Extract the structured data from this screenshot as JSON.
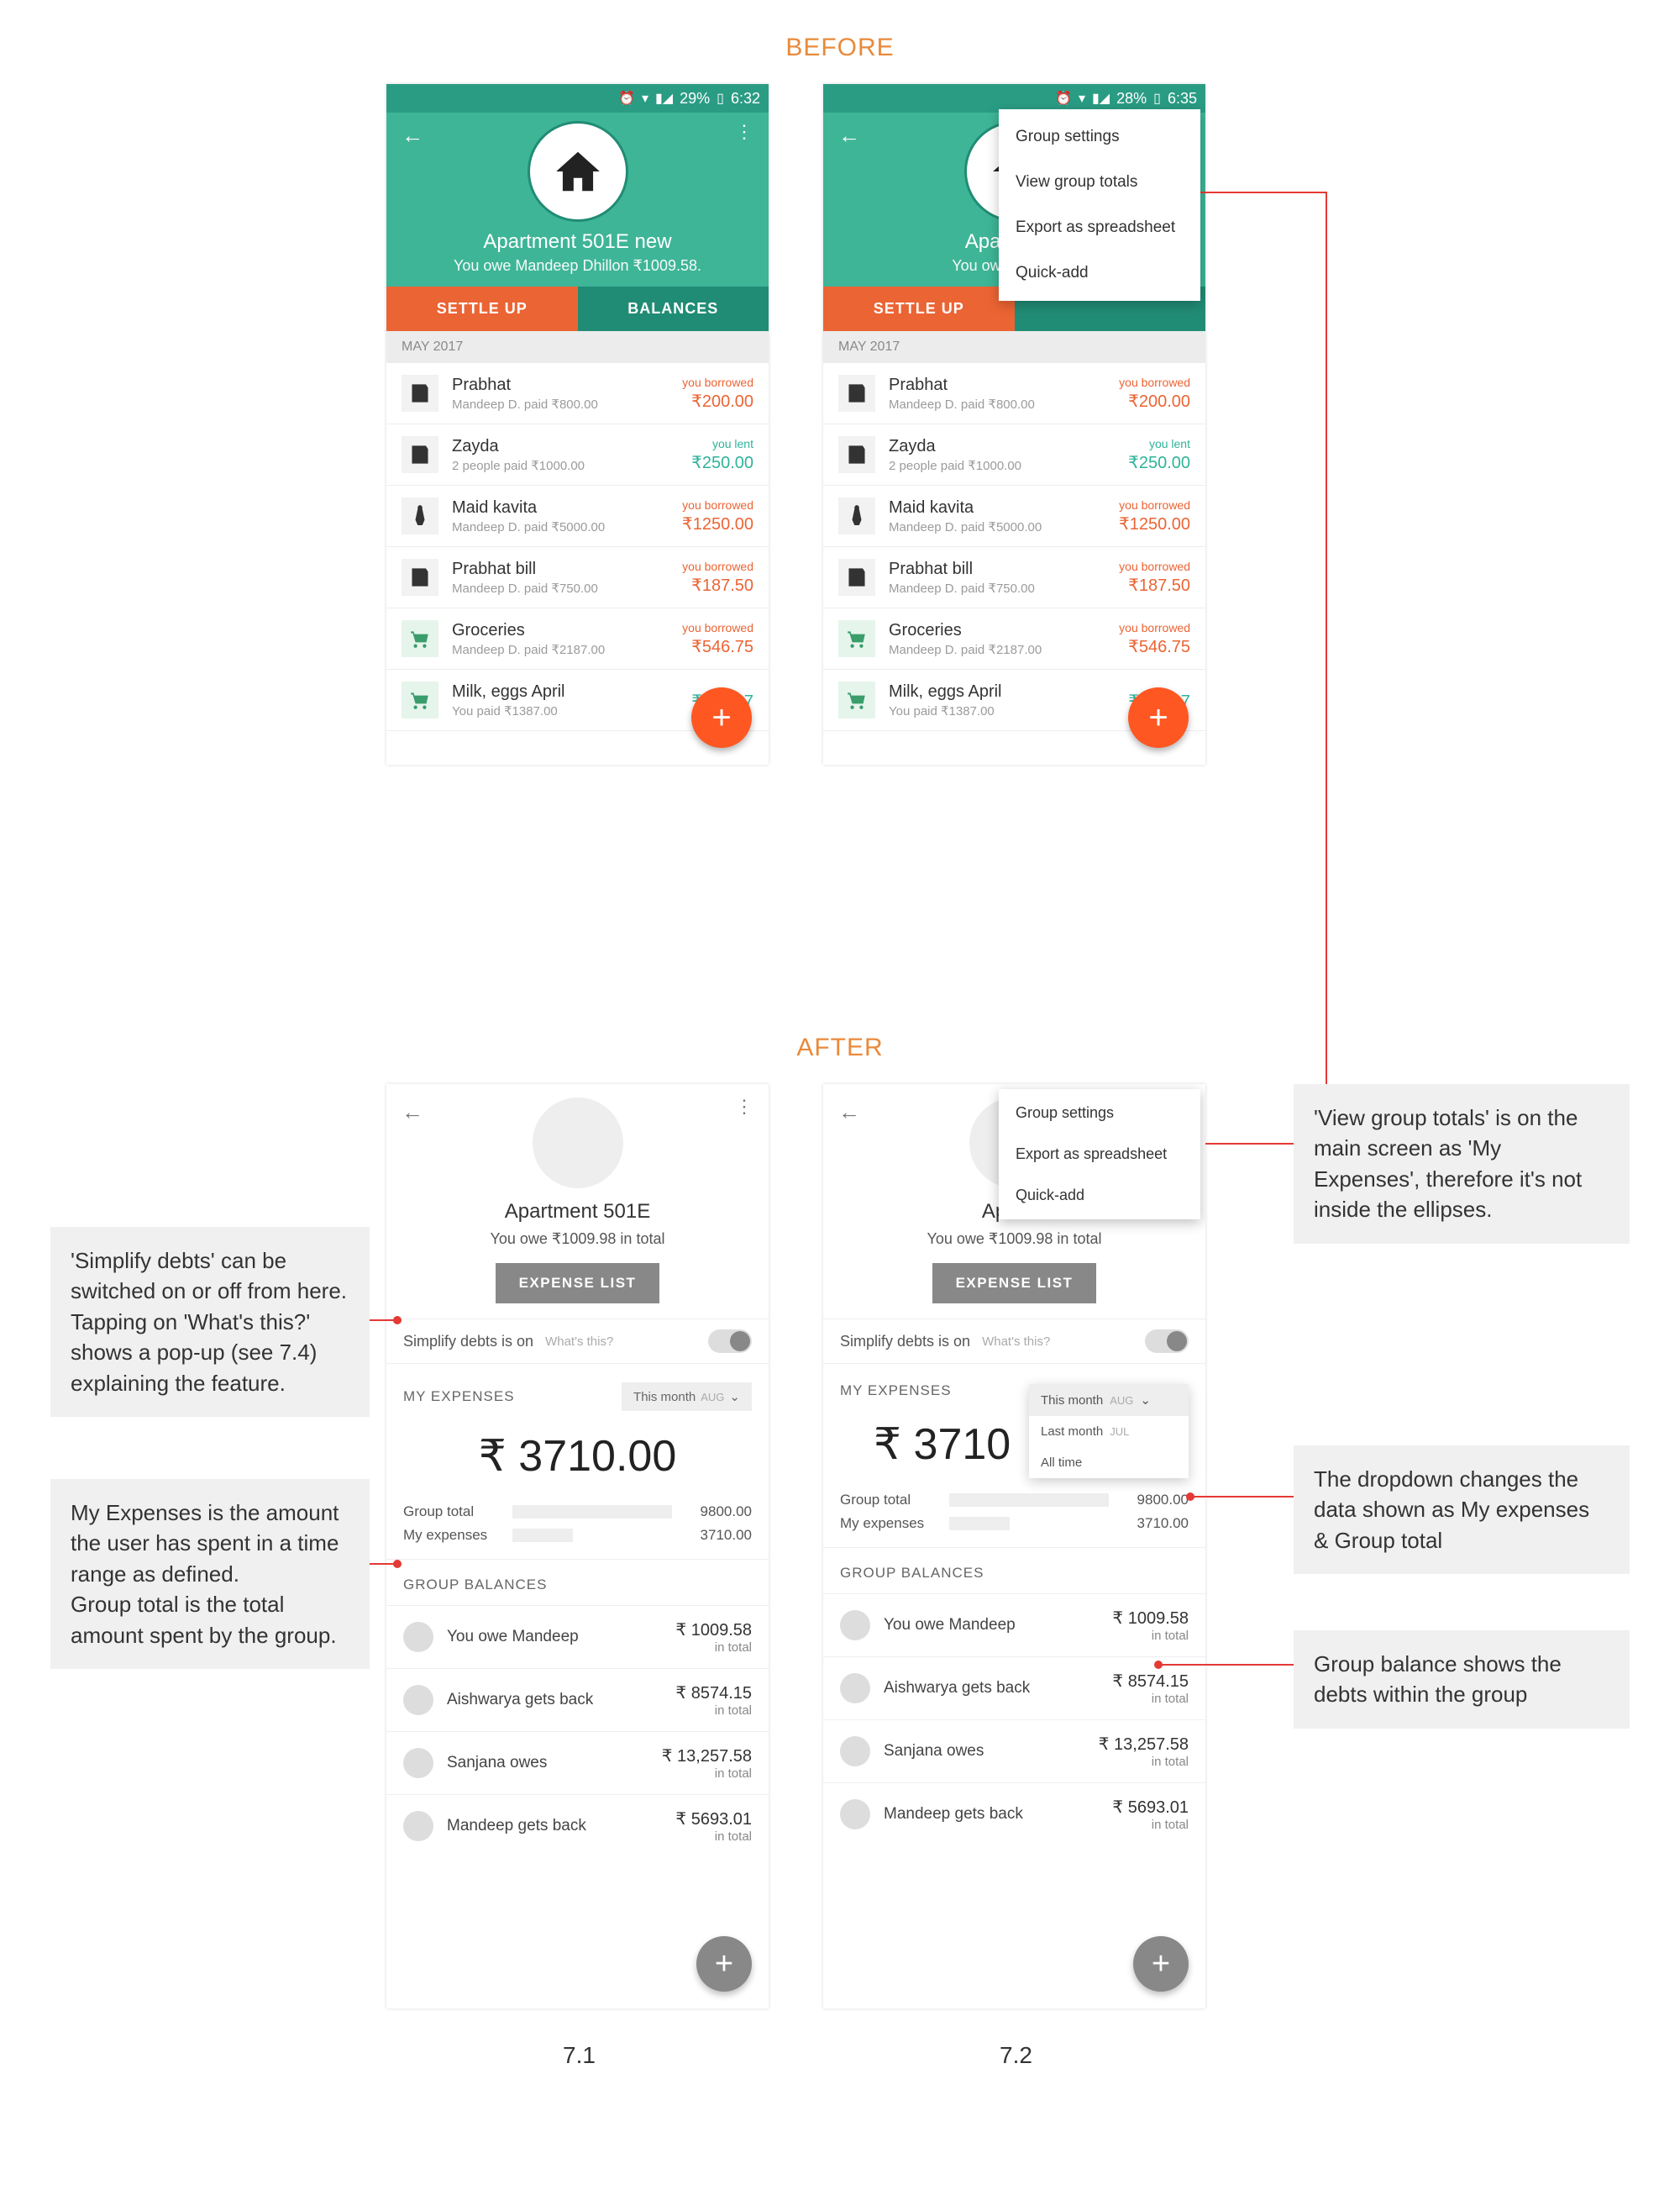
{
  "headings": {
    "before": "BEFORE",
    "after": "AFTER"
  },
  "before_status": {
    "battery": "29%",
    "time": "6:32"
  },
  "before_status2": {
    "battery": "28%",
    "time": "6:35"
  },
  "before_header": {
    "title": "Apartment 501E new",
    "subtitle": "You owe Mandeep Dhillon ₹1009.58.",
    "settle": "SETTLE UP",
    "balances": "BALANCES"
  },
  "month_label": "MAY 2017",
  "expenses": [
    {
      "title": "Prabhat",
      "sub": "Mandeep D. paid ₹800.00",
      "tag": "you borrowed",
      "amt": "₹200.00",
      "kind": "borrow",
      "icon": "receipt"
    },
    {
      "title": "Zayda",
      "sub": "2 people paid ₹1000.00",
      "tag": "you lent",
      "amt": "₹250.00",
      "kind": "lent",
      "icon": "receipt"
    },
    {
      "title": "Maid kavita",
      "sub": "Mandeep D. paid ₹5000.00",
      "tag": "you borrowed",
      "amt": "₹1250.00",
      "kind": "borrow",
      "icon": "maid"
    },
    {
      "title": "Prabhat bill",
      "sub": "Mandeep D. paid ₹750.00",
      "tag": "you borrowed",
      "amt": "₹187.50",
      "kind": "borrow",
      "icon": "receipt"
    },
    {
      "title": "Groceries",
      "sub": "Mandeep D. paid ₹2187.00",
      "tag": "you borrowed",
      "amt": "₹546.75",
      "kind": "borrow",
      "icon": "cart"
    },
    {
      "title": "Milk, eggs April",
      "sub": "You paid ₹1387.00",
      "tag": "",
      "amt": "₹924.67",
      "kind": "lent",
      "icon": "cart"
    }
  ],
  "before_menu": [
    "Group settings",
    "View group totals",
    "Export as spreadsheet",
    "Quick-add"
  ],
  "after_header": {
    "title": "Apartment 501E",
    "subtitle": "You owe ₹1009.98 in total",
    "btn": "EXPENSE LIST"
  },
  "simplify": {
    "label": "Simplify debts is on",
    "whats": "What's this?"
  },
  "myexp": {
    "label": "MY EXPENSES",
    "range_primary": "This month",
    "range_primary_mon": "AUG",
    "amount": "₹ 3710.00",
    "amount_trunc": "₹ 3710",
    "group_total_label": "Group total",
    "group_total_val": "9800.00",
    "my_expenses_label": "My expenses",
    "my_expenses_val": "3710.00"
  },
  "range_options": [
    {
      "label": "This month",
      "mon": "AUG"
    },
    {
      "label": "Last month",
      "mon": "JUL"
    },
    {
      "label": "All time",
      "mon": ""
    }
  ],
  "gbal": {
    "title": "GROUP BALANCES",
    "rows": [
      {
        "name": "You owe Mandeep",
        "amt": "₹ 1009.58",
        "sub": "in total"
      },
      {
        "name": "Aishwarya gets back",
        "amt": "₹ 8574.15",
        "sub": "in total"
      },
      {
        "name": "Sanjana owes",
        "amt": "₹ 13,257.58",
        "sub": "in total"
      },
      {
        "name": "Mandeep gets back",
        "amt": "₹ 5693.01",
        "sub": "in total"
      }
    ]
  },
  "after_menu": [
    "Group settings",
    "Export as spreadsheet",
    "Quick-add"
  ],
  "callouts": {
    "c1": "'Simplify debts' can be switched on or off from here. Tapping on 'What's this?' shows a pop-up (see 7.4) explaining the feature.",
    "c2": "My Expenses is the amount the user has spent in a time range as defined.\nGroup total is the total amount spent by the group.",
    "c3": "'View group totals' is on the main screen as 'My Expenses', therefore it's not inside the ellipses.",
    "c4": "The dropdown changes the data shown as My expenses & Group total",
    "c5": "Group balance shows the debts within the group"
  },
  "fig": {
    "a": "7.1",
    "b": "7.2"
  }
}
